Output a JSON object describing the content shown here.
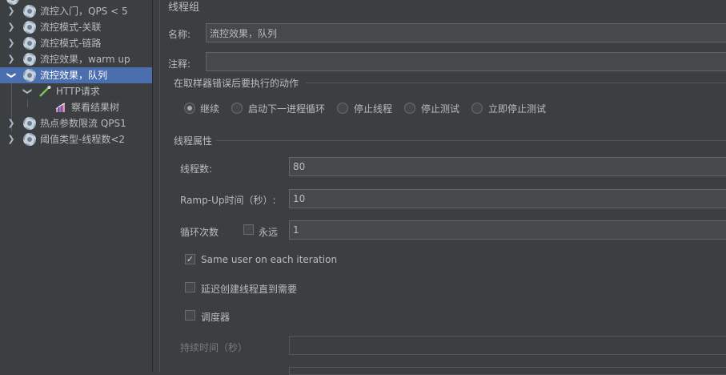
{
  "tree": {
    "items": [
      {
        "label": "流控入门，QPS < 5",
        "icon": "gear-icon"
      },
      {
        "label": "流控模式-关联",
        "icon": "gear-icon"
      },
      {
        "label": "流控模式-链路",
        "icon": "gear-icon"
      },
      {
        "label": "流控效果，warm up",
        "icon": "gear-icon"
      },
      {
        "label": "流控效果，队列",
        "icon": "gear-icon",
        "selected": true
      },
      {
        "label": "HTTP请求",
        "icon": "pipette-icon"
      },
      {
        "label": "察看结果树",
        "icon": "chart-icon"
      },
      {
        "label": "热点参数限流 QPS1",
        "icon": "gear-icon"
      },
      {
        "label": "阈值类型-线程数<2",
        "icon": "gear-icon"
      }
    ]
  },
  "panel": {
    "title": "线程组",
    "name_label": "名称:",
    "name_value": "流控效果，队列",
    "comment_label": "注释:",
    "comment_value": "",
    "error_group_label": "在取样器错误后要执行的动作",
    "error_actions": [
      {
        "label": "继续",
        "selected": true
      },
      {
        "label": "启动下一进程循环",
        "selected": false
      },
      {
        "label": "停止线程",
        "selected": false
      },
      {
        "label": "停止测试",
        "selected": false
      },
      {
        "label": "立即停止测试",
        "selected": false
      }
    ],
    "thread_props_label": "线程属性",
    "threads_label": "线程数:",
    "threads_value": "80",
    "rampup_label": "Ramp-Up时间（秒）:",
    "rampup_value": "10",
    "loop_label": "循环次数",
    "forever_label": "永远",
    "forever_checked": false,
    "loop_value": "1",
    "same_user_label": "Same user on each iteration",
    "same_user_checked": true,
    "delay_label": "延迟创建线程直到需要",
    "delay_checked": false,
    "scheduler_label": "调度器",
    "scheduler_checked": false,
    "duration_label": "持续时间（秒）",
    "duration_value": ""
  },
  "colors": {
    "background": "#3c3f41",
    "selection": "#4b6eaf",
    "field": "#45494a",
    "text": "#bbbbbb"
  }
}
